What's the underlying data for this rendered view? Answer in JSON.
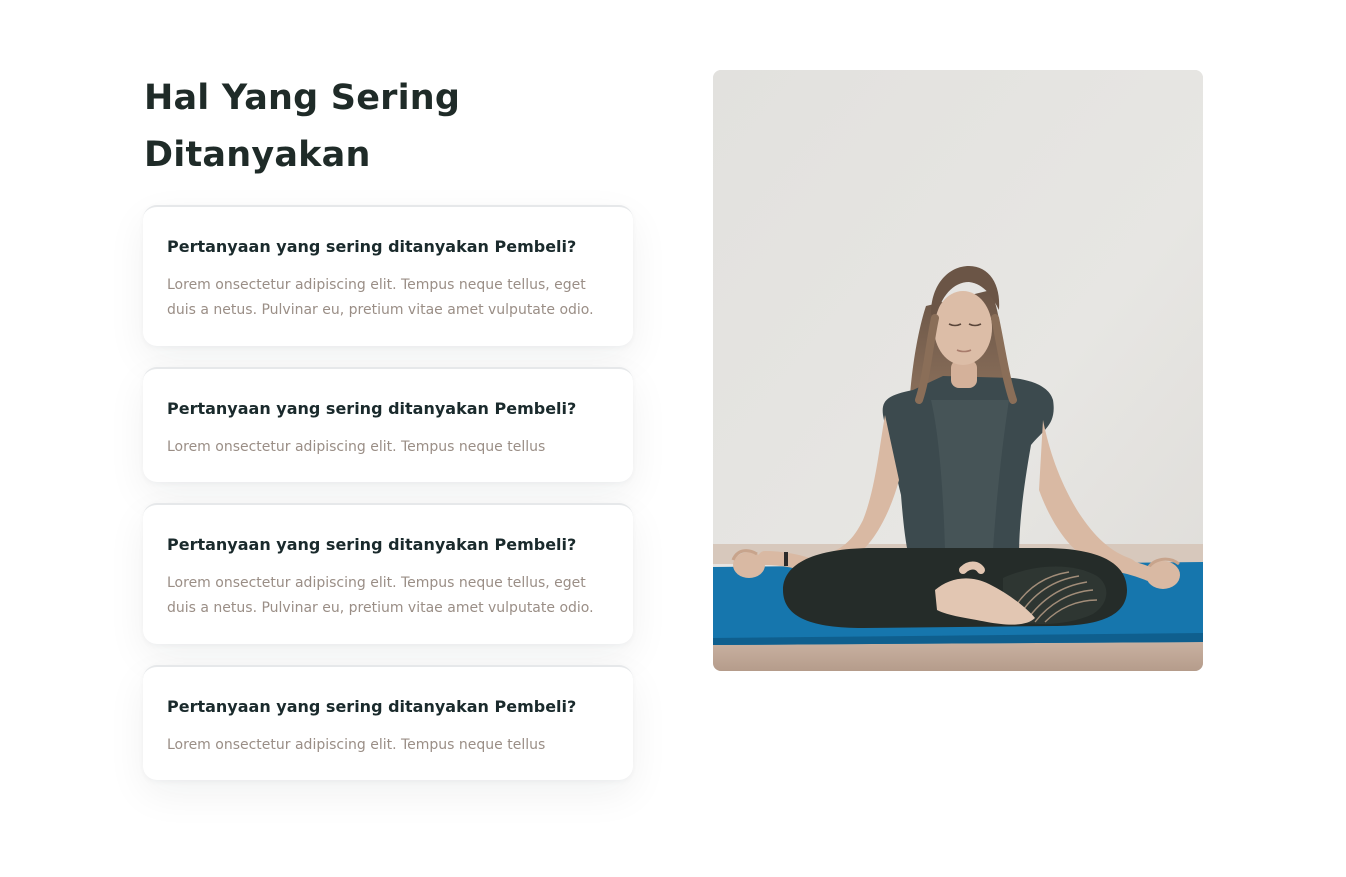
{
  "section": {
    "title": "Hal Yang Sering Ditanyakan"
  },
  "faq": [
    {
      "question": "Pertanyaan yang sering ditanyakan Pembeli?",
      "answer": "Lorem onsectetur adipiscing elit. Tempus neque tellus, eget duis a netus. Pulvinar eu, pretium vitae amet vulputate odio."
    },
    {
      "question": "Pertanyaan yang sering ditanyakan Pembeli?",
      "answer": "Lorem onsectetur adipiscing elit. Tempus neque tellus"
    },
    {
      "question": "Pertanyaan yang sering ditanyakan Pembeli?",
      "answer": "Lorem onsectetur adipiscing elit. Tempus neque tellus, eget duis a netus. Pulvinar eu, pretium vitae amet vulputate odio."
    },
    {
      "question": "Pertanyaan yang sering ditanyakan Pembeli?",
      "answer": "Lorem onsectetur adipiscing elit. Tempus neque tellus"
    }
  ],
  "image": {
    "subject": "woman-meditating-yoga-pose-photo"
  },
  "colors": {
    "heading": "#1f2b28",
    "question": "#1a2a2c",
    "answer": "#9a8e86",
    "mat": "#1676ad",
    "wall": "#e4e3e0",
    "floor": "#bba393"
  }
}
